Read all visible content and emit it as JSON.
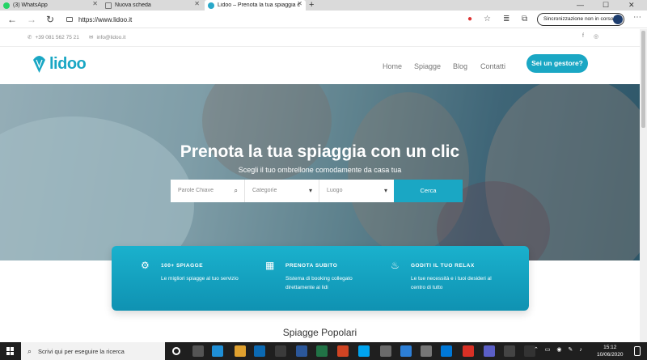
{
  "browser": {
    "tabs": [
      {
        "title": "(3) WhatsApp",
        "icon": "whatsapp-icon"
      },
      {
        "title": "Nuova scheda",
        "icon": "new-tab-icon"
      },
      {
        "title": "Lidoo – Prenota la tua spiaggia c",
        "icon": "lidoo-favicon-icon"
      }
    ],
    "url": "https://www.lidoo.it",
    "sync_label": "Sincronizzazione non in corso"
  },
  "site": {
    "topbar": {
      "phone": "+39 081 562 75 21",
      "email": "info@lidoo.it"
    },
    "logo_text": "lidoo",
    "nav": {
      "items": [
        "Home",
        "Spiagge",
        "Blog",
        "Contatti"
      ],
      "cta_label": "Sei un gestore?"
    },
    "hero": {
      "title": "Prenota la tua spiaggia con un clic",
      "subtitle": "Scegli il tuo ombrellone comodamente da casa tua"
    },
    "search": {
      "keyword_placeholder": "Parole Chiave",
      "category_label": "Categorie",
      "location_label": "Luogo",
      "button_label": "Cerca"
    },
    "features": [
      {
        "icon": "gear-icon",
        "title": "100+ SPIAGGE",
        "desc": "Le migliori spiagge al tuo servizio"
      },
      {
        "icon": "calendar-icon",
        "title": "PRENOTA SUBITO",
        "desc": "Sistema di booking collegato direttamente ai lidi"
      },
      {
        "icon": "relax-icon",
        "title": "GODITI IL TUO RELAX",
        "desc": "Le tue necessità e i tuoi desideri al centro di tutto"
      }
    ],
    "section_title": "Spiagge Popolari",
    "colors": {
      "accent": "#1aa7c4",
      "feature_bg": "#1196b6"
    }
  },
  "taskbar": {
    "search_placeholder": "Scrivi qui per eseguire la ricerca",
    "time": "15:12",
    "date": "10/06/2020"
  }
}
